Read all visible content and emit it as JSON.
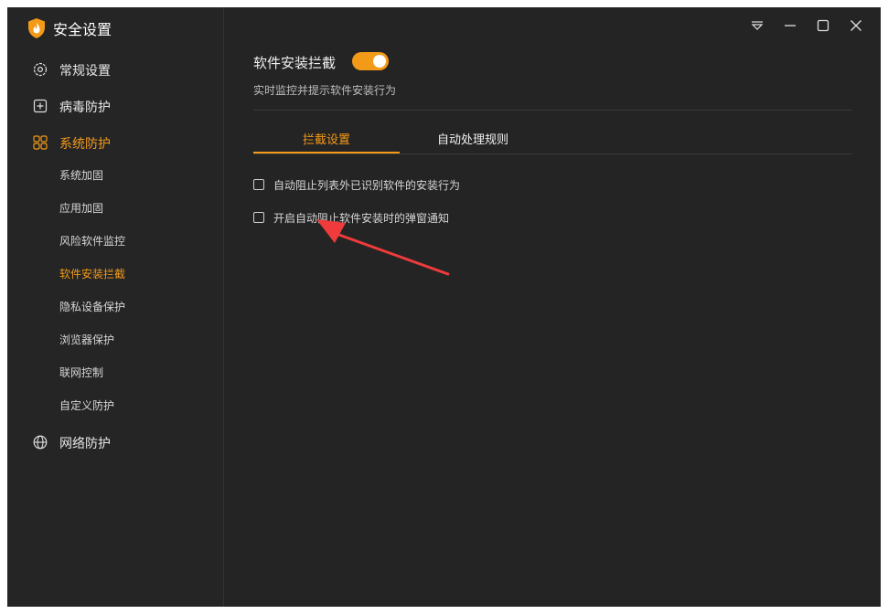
{
  "app": {
    "title": "安全设置"
  },
  "sidebar": {
    "groups": [
      {
        "label": "常规设置",
        "icon": "gear-icon"
      },
      {
        "label": "病毒防护",
        "icon": "plus-box-icon"
      },
      {
        "label": "系统防护",
        "icon": "grid-icon"
      },
      {
        "label": "网络防护",
        "icon": "globe-icon"
      }
    ],
    "sub_items": [
      "系统加固",
      "应用加固",
      "风险软件监控",
      "软件安装拦截",
      "隐私设备保护",
      "浏览器保护",
      "联网控制",
      "自定义防护"
    ],
    "active_group": "系统防护",
    "active_sub": "软件安装拦截"
  },
  "window_controls": [
    "menu-icon",
    "minimize-icon",
    "maximize-icon",
    "close-icon"
  ],
  "main": {
    "section_title": "软件安装拦截",
    "toggle_on": true,
    "section_desc": "实时监控并提示软件安装行为",
    "tabs": [
      {
        "label": "拦截设置",
        "active": true
      },
      {
        "label": "自动处理规则",
        "active": false
      }
    ],
    "options": [
      {
        "label": "自动阻止列表外已识别软件的安装行为",
        "checked": false
      },
      {
        "label": "开启自动阻止软件安装时的弹窗通知",
        "checked": false
      }
    ]
  },
  "colors": {
    "accent": "#f39a19",
    "background": "#242424",
    "annotation": "#ef3b3b"
  }
}
